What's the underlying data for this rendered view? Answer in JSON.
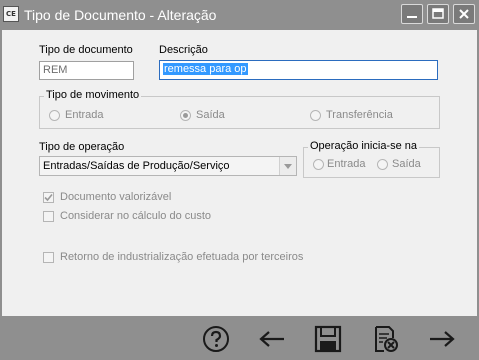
{
  "window": {
    "app_icon_text": "CE",
    "title": "Tipo de Documento - Alteração",
    "controls": [
      "minimize-icon",
      "maximize-icon",
      "close-icon"
    ]
  },
  "form": {
    "tipo_documento": {
      "label": "Tipo de documento",
      "value": "REM"
    },
    "descricao": {
      "label": "Descrição",
      "value": "remessa para op"
    },
    "tipo_movimento": {
      "legend": "Tipo de movimento",
      "options": [
        {
          "label": "Entrada",
          "checked": false
        },
        {
          "label": "Saída",
          "checked": true
        },
        {
          "label": "Transferência",
          "checked": false
        }
      ]
    },
    "tipo_operacao": {
      "label": "Tipo de operação",
      "value": "Entradas/Saídas de Produção/Serviço"
    },
    "operacao_inicia": {
      "legend": "Operação inicia-se na",
      "options": [
        {
          "label": "Entrada",
          "checked": false
        },
        {
          "label": "Saída",
          "checked": false
        }
      ]
    },
    "checks": {
      "documento_valorizavel": {
        "label": "Documento valorizável",
        "checked": true
      },
      "considerar_custo": {
        "label": "Considerar no cálculo do custo",
        "checked": false
      },
      "retorno_industrializacao": {
        "label": "Retorno de industrialização efetuada por terceiros",
        "checked": false
      }
    }
  },
  "toolbar": {
    "buttons": [
      "help-icon",
      "back-arrow-icon",
      "save-disk-icon",
      "cancel-document-icon",
      "forward-arrow-icon"
    ]
  },
  "colors": {
    "chrome": "#8f8f8f",
    "client_bg": "#f0f0f0",
    "focus_border": "#2b6cbf",
    "selection": "#3399ff"
  }
}
